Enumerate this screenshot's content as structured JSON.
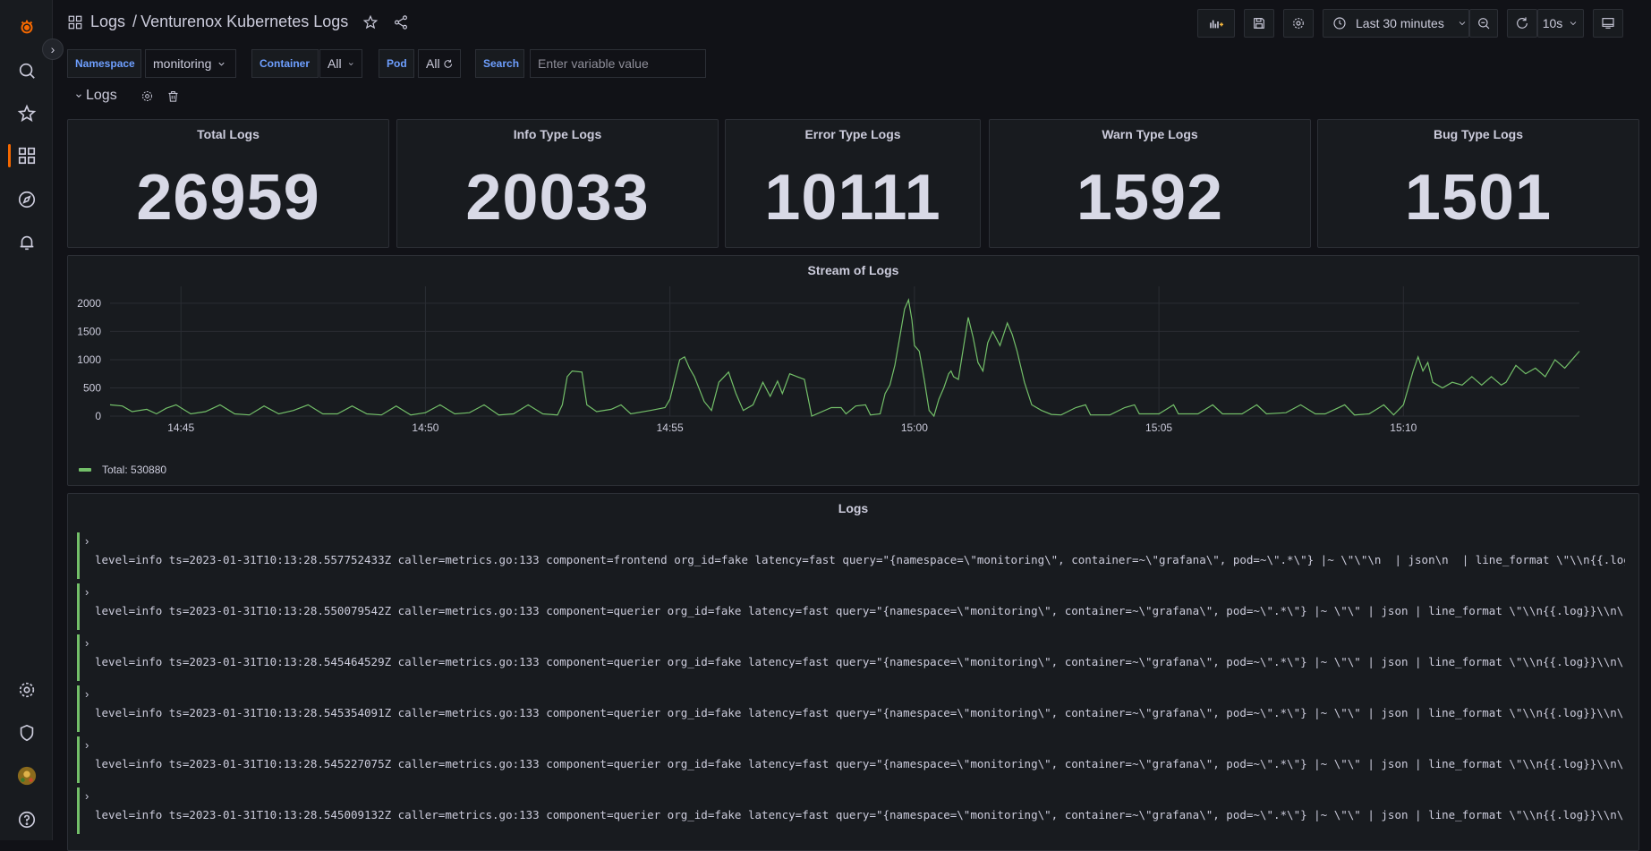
{
  "sidebar": {
    "icons": [
      "grafana-logo-icon",
      "search-icon",
      "star-icon",
      "dashboards-icon",
      "explore-icon",
      "alerting-icon",
      "gear-icon",
      "shield-icon",
      "avatar",
      "help-icon"
    ]
  },
  "topnav": {
    "folder": "Logs",
    "separator": "/",
    "title": "Venturenox Kubernetes Logs",
    "time_range": "Last 30 minutes",
    "refresh_interval": "10s"
  },
  "variables": [
    {
      "label": "Namespace",
      "value": "monitoring"
    },
    {
      "label": "Container",
      "value": "All"
    },
    {
      "label": "Pod",
      "value": "All"
    },
    {
      "label": "Search",
      "placeholder": "Enter variable value"
    }
  ],
  "row": {
    "title": "Logs"
  },
  "stats": [
    {
      "title": "Total Logs",
      "value": "26959"
    },
    {
      "title": "Info Type Logs",
      "value": "20033"
    },
    {
      "title": "Error Type Logs",
      "value": "10111"
    },
    {
      "title": "Warn Type Logs",
      "value": "1592"
    },
    {
      "title": "Bug Type Logs",
      "value": "1501"
    }
  ],
  "stream_panel": {
    "title": "Stream of Logs",
    "legend": "Total: 530880"
  },
  "chart_data": {
    "type": "line",
    "title": "Stream of Logs",
    "xlabel": "",
    "ylabel": "",
    "color": "#73bf69",
    "xlim": [
      -1.45,
      28.6
    ],
    "ylim": [
      0,
      2300
    ],
    "yticks": [
      0,
      500,
      1000,
      1500,
      2000
    ],
    "xticks": [
      {
        "v": 0,
        "label": "14:45"
      },
      {
        "v": 5,
        "label": "14:50"
      },
      {
        "v": 10,
        "label": "14:55"
      },
      {
        "v": 15,
        "label": "15:00"
      },
      {
        "v": 20,
        "label": "15:05"
      },
      {
        "v": 25,
        "label": "15:10"
      }
    ],
    "grid": true,
    "legend": "bottom-left",
    "series": [
      {
        "name": "Total",
        "points": [
          [
            -1.45,
            200
          ],
          [
            -1.2,
            180
          ],
          [
            -1.0,
            80
          ],
          [
            -0.7,
            120
          ],
          [
            -0.5,
            40
          ],
          [
            -0.3,
            140
          ],
          [
            -0.1,
            200
          ],
          [
            0.2,
            40
          ],
          [
            0.5,
            80
          ],
          [
            0.8,
            200
          ],
          [
            1.1,
            40
          ],
          [
            1.4,
            20
          ],
          [
            1.7,
            180
          ],
          [
            2.0,
            40
          ],
          [
            2.3,
            100
          ],
          [
            2.6,
            200
          ],
          [
            2.9,
            40
          ],
          [
            3.2,
            40
          ],
          [
            3.5,
            180
          ],
          [
            3.8,
            40
          ],
          [
            4.1,
            20
          ],
          [
            4.4,
            180
          ],
          [
            4.7,
            20
          ],
          [
            5.0,
            60
          ],
          [
            5.3,
            200
          ],
          [
            5.6,
            40
          ],
          [
            5.9,
            60
          ],
          [
            6.2,
            200
          ],
          [
            6.5,
            20
          ],
          [
            6.8,
            40
          ],
          [
            7.1,
            200
          ],
          [
            7.4,
            40
          ],
          [
            7.7,
            20
          ],
          [
            7.8,
            200
          ],
          [
            7.9,
            700
          ],
          [
            8.0,
            800
          ],
          [
            8.2,
            780
          ],
          [
            8.3,
            200
          ],
          [
            8.5,
            80
          ],
          [
            8.8,
            120
          ],
          [
            9.0,
            200
          ],
          [
            9.2,
            40
          ],
          [
            9.6,
            100
          ],
          [
            9.9,
            150
          ],
          [
            10.0,
            300
          ],
          [
            10.1,
            650
          ],
          [
            10.2,
            1000
          ],
          [
            10.3,
            1050
          ],
          [
            10.4,
            850
          ],
          [
            10.5,
            700
          ],
          [
            10.7,
            260
          ],
          [
            10.85,
            100
          ],
          [
            11.0,
            600
          ],
          [
            11.2,
            780
          ],
          [
            11.35,
            400
          ],
          [
            11.5,
            100
          ],
          [
            11.7,
            200
          ],
          [
            11.8,
            400
          ],
          [
            11.9,
            600
          ],
          [
            12.05,
            350
          ],
          [
            12.2,
            620
          ],
          [
            12.3,
            400
          ],
          [
            12.45,
            750
          ],
          [
            12.6,
            700
          ],
          [
            12.75,
            650
          ],
          [
            12.9,
            0
          ],
          [
            13.3,
            150
          ],
          [
            13.5,
            150
          ],
          [
            13.6,
            40
          ],
          [
            13.8,
            180
          ],
          [
            14.0,
            200
          ],
          [
            14.1,
            20
          ],
          [
            14.3,
            40
          ],
          [
            14.4,
            400
          ],
          [
            14.5,
            550
          ],
          [
            14.6,
            900
          ],
          [
            14.7,
            1400
          ],
          [
            14.8,
            1900
          ],
          [
            14.88,
            2060
          ],
          [
            14.95,
            1700
          ],
          [
            15.0,
            1250
          ],
          [
            15.1,
            1150
          ],
          [
            15.2,
            650
          ],
          [
            15.3,
            100
          ],
          [
            15.4,
            0
          ],
          [
            15.5,
            300
          ],
          [
            15.6,
            500
          ],
          [
            15.7,
            750
          ],
          [
            15.75,
            800
          ],
          [
            15.8,
            700
          ],
          [
            15.9,
            650
          ],
          [
            16.0,
            1200
          ],
          [
            16.1,
            1750
          ],
          [
            16.2,
            1400
          ],
          [
            16.3,
            950
          ],
          [
            16.4,
            800
          ],
          [
            16.5,
            1300
          ],
          [
            16.6,
            1500
          ],
          [
            16.75,
            1250
          ],
          [
            16.9,
            1650
          ],
          [
            17.0,
            1450
          ],
          [
            17.1,
            1150
          ],
          [
            17.25,
            600
          ],
          [
            17.4,
            200
          ],
          [
            17.6,
            100
          ],
          [
            17.8,
            30
          ],
          [
            18.0,
            20
          ],
          [
            18.3,
            150
          ],
          [
            18.5,
            200
          ],
          [
            18.6,
            20
          ],
          [
            19.0,
            20
          ],
          [
            19.3,
            150
          ],
          [
            19.5,
            200
          ],
          [
            19.6,
            40
          ],
          [
            20.0,
            40
          ],
          [
            20.3,
            200
          ],
          [
            20.4,
            40
          ],
          [
            20.8,
            40
          ],
          [
            21.1,
            200
          ],
          [
            21.3,
            40
          ],
          [
            21.7,
            40
          ],
          [
            22.0,
            200
          ],
          [
            22.2,
            40
          ],
          [
            22.6,
            60
          ],
          [
            22.9,
            200
          ],
          [
            23.2,
            40
          ],
          [
            23.4,
            40
          ],
          [
            23.8,
            200
          ],
          [
            24.0,
            20
          ],
          [
            24.3,
            40
          ],
          [
            24.6,
            200
          ],
          [
            24.8,
            20
          ],
          [
            25.0,
            200
          ],
          [
            25.2,
            800
          ],
          [
            25.3,
            1050
          ],
          [
            25.4,
            800
          ],
          [
            25.5,
            950
          ],
          [
            25.6,
            600
          ],
          [
            25.8,
            500
          ],
          [
            26.0,
            600
          ],
          [
            26.2,
            550
          ],
          [
            26.4,
            700
          ],
          [
            26.6,
            550
          ],
          [
            26.8,
            700
          ],
          [
            27.0,
            550
          ],
          [
            27.1,
            600
          ],
          [
            27.3,
            900
          ],
          [
            27.5,
            750
          ],
          [
            27.7,
            850
          ],
          [
            27.9,
            700
          ],
          [
            28.1,
            1000
          ],
          [
            28.3,
            850
          ],
          [
            28.5,
            1050
          ],
          [
            28.6,
            1150
          ]
        ]
      }
    ]
  },
  "logs_panel": {
    "title": "Logs",
    "lines": [
      "level=info ts=2023-01-31T10:13:28.557752433Z caller=metrics.go:133 component=frontend org_id=fake latency=fast query=\"{namespace=\\\"monitoring\\\", container=~\\\"grafana\\\", pod=~\\\".*\\\"} |~ \\\"\\\"\\n  | json\\n  | line_format \\\"\\\\n{{.log}}\\\\n\\\"",
      "level=info ts=2023-01-31T10:13:28.550079542Z caller=metrics.go:133 component=querier org_id=fake latency=fast query=\"{namespace=\\\"monitoring\\\", container=~\\\"grafana\\\", pod=~\\\".*\\\"} |~ \\\"\\\" | json | line_format \\\"\\\\n{{.log}}\\\\n\\\" | __e",
      "level=info ts=2023-01-31T10:13:28.545464529Z caller=metrics.go:133 component=querier org_id=fake latency=fast query=\"{namespace=\\\"monitoring\\\", container=~\\\"grafana\\\", pod=~\\\".*\\\"} |~ \\\"\\\" | json | line_format \\\"\\\\n{{.log}}\\\\n\\\" | __e",
      "level=info ts=2023-01-31T10:13:28.545354091Z caller=metrics.go:133 component=querier org_id=fake latency=fast query=\"{namespace=\\\"monitoring\\\", container=~\\\"grafana\\\", pod=~\\\".*\\\"} |~ \\\"\\\" | json | line_format \\\"\\\\n{{.log}}\\\\n\\\" | __e",
      "level=info ts=2023-01-31T10:13:28.545227075Z caller=metrics.go:133 component=querier org_id=fake latency=fast query=\"{namespace=\\\"monitoring\\\", container=~\\\"grafana\\\", pod=~\\\".*\\\"} |~ \\\"\\\" | json | line_format \\\"\\\\n{{.log}}\\\\n\\\" | __e",
      "level=info ts=2023-01-31T10:13:28.545009132Z caller=metrics.go:133 component=querier org_id=fake latency=fast query=\"{namespace=\\\"monitoring\\\", container=~\\\"grafana\\\", pod=~\\\".*\\\"} |~ \\\"\\\" | json | line_format \\\"\\\\n{{.log}}\\\\n\\\" | __e"
    ]
  }
}
